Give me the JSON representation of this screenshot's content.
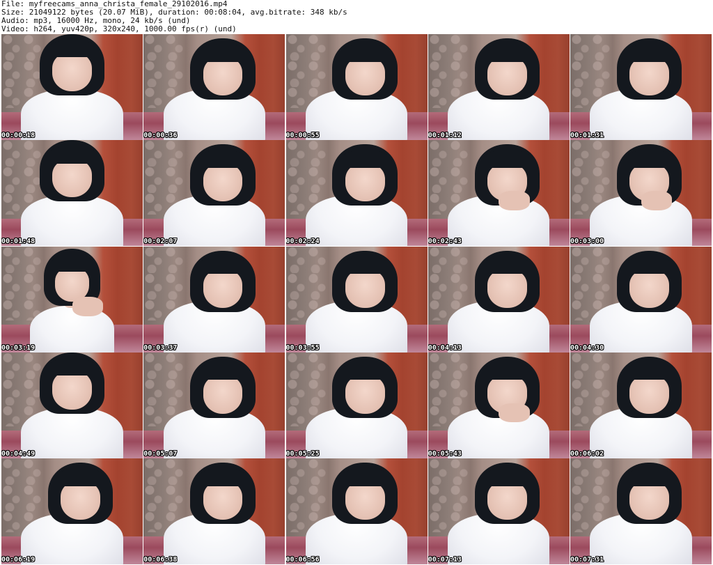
{
  "header": {
    "file_line": "File: myfreecams_anna_christa_female_29102016.mp4",
    "size_line": "Size: 21049122 bytes (20.07 MiB), duration: 00:08:04, avg.bitrate: 348 kb/s",
    "audio_line": "Audio: mp3, 16000 Hz, mono, 24 kb/s (und)",
    "video_line": "Video: h264, yuv420p, 320x240, 1000.00 fps(r) (und)"
  },
  "thumbnails": [
    {
      "timestamp": "00:00:18"
    },
    {
      "timestamp": "00:00:36"
    },
    {
      "timestamp": "00:00:55"
    },
    {
      "timestamp": "00:01:12"
    },
    {
      "timestamp": "00:01:31"
    },
    {
      "timestamp": "00:01:48"
    },
    {
      "timestamp": "00:02:07"
    },
    {
      "timestamp": "00:02:24"
    },
    {
      "timestamp": "00:02:43"
    },
    {
      "timestamp": "00:03:00"
    },
    {
      "timestamp": "00:03:19"
    },
    {
      "timestamp": "00:03:37"
    },
    {
      "timestamp": "00:03:55"
    },
    {
      "timestamp": "00:04:13"
    },
    {
      "timestamp": "00:04:30"
    },
    {
      "timestamp": "00:04:49"
    },
    {
      "timestamp": "00:05:07"
    },
    {
      "timestamp": "00:05:25"
    },
    {
      "timestamp": "00:05:43"
    },
    {
      "timestamp": "00:06:02"
    },
    {
      "timestamp": "00:06:19"
    },
    {
      "timestamp": "00:06:38"
    },
    {
      "timestamp": "00:06:56"
    },
    {
      "timestamp": "00:07:13"
    },
    {
      "timestamp": "00:07:31"
    }
  ],
  "colors": {
    "timestamp_text": "#ffffff",
    "timestamp_outline": "#000000",
    "header_text": "#111111",
    "background": "#ffffff"
  }
}
